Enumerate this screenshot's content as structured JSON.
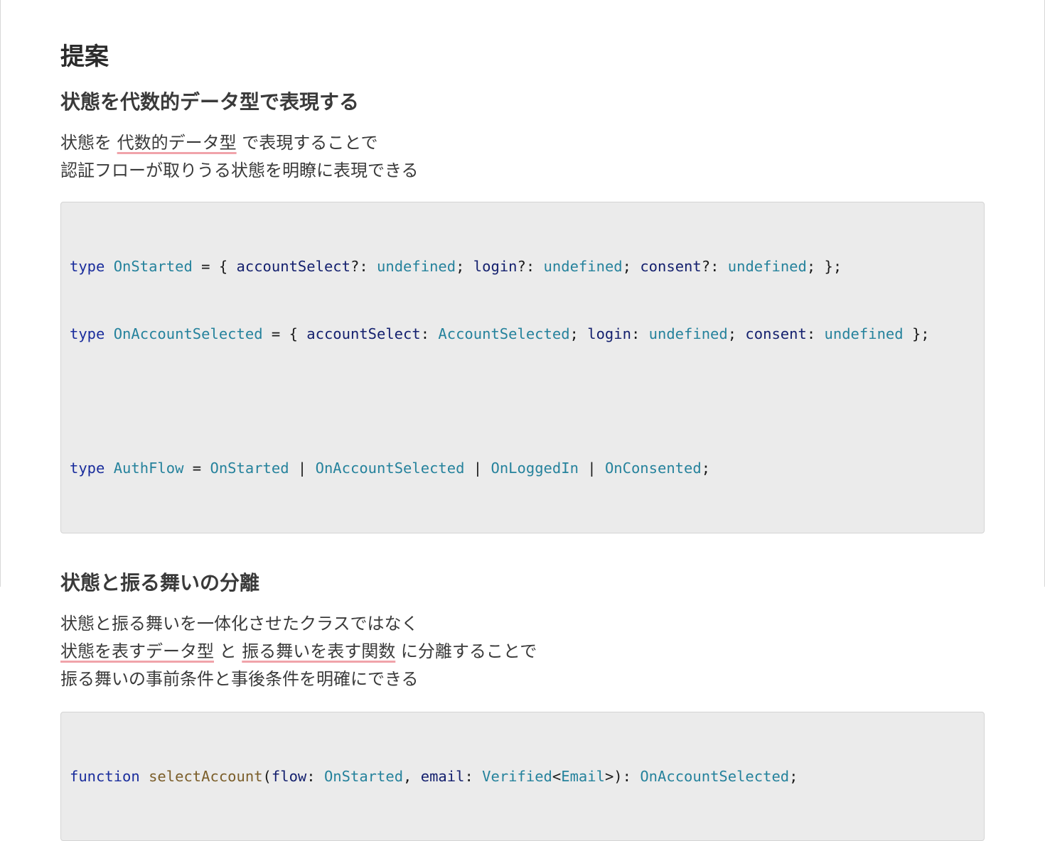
{
  "title": "提案",
  "section1": {
    "heading": "状態を代数的データ型で表現する",
    "line1": {
      "pre": "状態を",
      "highlight": "代数的データ型",
      "post": "で表現することで"
    },
    "line2": "認証フローが取りうる状態を明瞭に表現できる",
    "code": {
      "line1": [
        "type",
        " ",
        "OnStarted",
        " = { ",
        "accountSelect",
        "?: ",
        "undefined",
        "; ",
        "login",
        "?: ",
        "undefined",
        "; ",
        "consent",
        "?: ",
        "undefined",
        "; };"
      ],
      "line2": [
        "type",
        " ",
        "OnAccountSelected",
        " = { ",
        "accountSelect",
        ": ",
        "AccountSelected",
        "; ",
        "login",
        ": ",
        "undefined",
        "; ",
        "consent",
        ": ",
        "undefined",
        " };"
      ],
      "line4": [
        "type",
        " ",
        "AuthFlow",
        " = ",
        "OnStarted",
        " | ",
        "OnAccountSelected",
        " | ",
        "OnLoggedIn",
        " | ",
        "OnConsented",
        ";"
      ]
    }
  },
  "section2": {
    "heading": "状態と振る舞いの分離",
    "line1": "状態と振る舞いを一体化させたクラスではなく",
    "line2": {
      "highlight1": "状態を表すデータ型",
      "mid": "と",
      "highlight2": "振る舞いを表す関数",
      "post": "に分離することで"
    },
    "line3": "振る舞いの事前条件と事後条件を明確にできる",
    "code": {
      "line1": [
        "function",
        " ",
        "selectAccount",
        "(",
        "flow",
        ": ",
        "OnStarted",
        ", ",
        "email",
        ": ",
        "Verified",
        "<",
        "Email",
        ">): ",
        "OnAccountSelected",
        ";"
      ]
    }
  },
  "colors": {
    "keyword": "#1a2d9c",
    "type_name": "#25829c",
    "function_name": "#7b5e2a",
    "property": "#14206e",
    "underline": "#f0a3aa",
    "code_background": "#ebebeb"
  }
}
